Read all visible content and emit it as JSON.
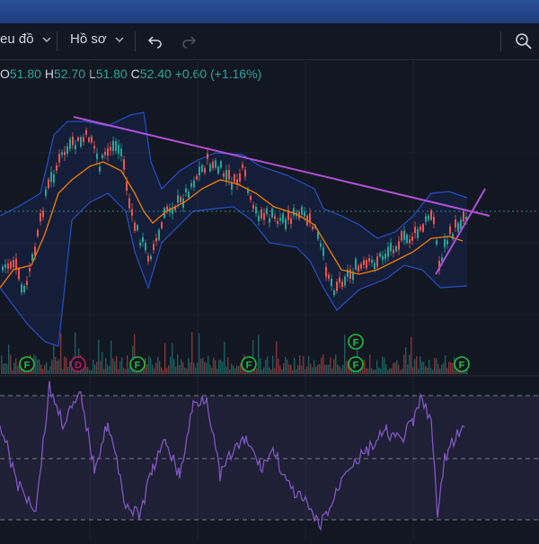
{
  "toolbar": {
    "chart_label": "eu đồ",
    "profile_label": "Hồ sơ"
  },
  "legend": {
    "o_key": "O",
    "o_val": "51.80",
    "h_key": "H",
    "h_val": "52.70",
    "l_key": "L",
    "l_val": "51.80",
    "c_key": "C",
    "c_val": "52.40",
    "change": "+0.60 (+1.16%)"
  },
  "badges": {
    "f": "F",
    "d": "D"
  },
  "colors": {
    "background": "#131722",
    "up": "#26a69a",
    "down": "#ef5350",
    "bollinger": "#2962ff",
    "ma": "#f57c00",
    "trendline": "#b04fd6",
    "rsi": "#7e57c2",
    "badge_f": "#1fbf3a",
    "badge_d": "#c2185b"
  },
  "icons": {
    "undo": "undo-icon",
    "redo": "redo-icon",
    "search": "search-icon"
  }
}
